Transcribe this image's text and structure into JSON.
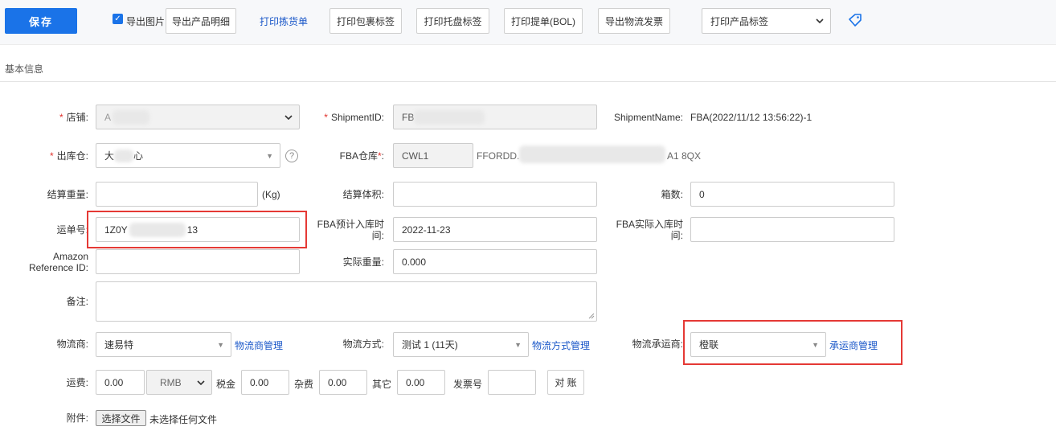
{
  "toolbar": {
    "save": "保存",
    "export_images": "导出图片",
    "export_products": "导出产品明细",
    "print_picklist": "打印拣货单",
    "print_package": "打印包裹标签",
    "print_pallet": "打印托盘标签",
    "print_bol": "打印提单(BOL)",
    "export_invoice": "导出物流发票",
    "print_product_select": "打印产品标签"
  },
  "section_title": "基本信息",
  "form": {
    "store": {
      "label": "店铺",
      "value": "A"
    },
    "shipment_id": {
      "label": "ShipmentID",
      "value": "FB"
    },
    "shipment_name": {
      "label": "ShipmentName",
      "value": "FBA(2022/11/12 13:56:22)-1"
    },
    "warehouse_out": {
      "label": "出库仓",
      "value_a": "大",
      "value_b": "心"
    },
    "fba_warehouse": {
      "label": "FBA仓库",
      "code": "CWL1",
      "addr_a": "FFORDD.",
      "addr_b": "A1 8QX"
    },
    "settle_weight": {
      "label": "结算重量",
      "unit": "(Kg)",
      "value": ""
    },
    "settle_volume": {
      "label": "结算体积",
      "value": ""
    },
    "box_count": {
      "label": "箱数",
      "value": "0"
    },
    "tracking_no": {
      "label": "运单号",
      "value_a": "1Z0Y",
      "value_b": "13"
    },
    "fba_expected": {
      "label_1": "FBA预计入库时",
      "label_2": "间",
      "value": "2022-11-23"
    },
    "fba_actual": {
      "label_1": "FBA实际入库时",
      "label_2": "间",
      "value": ""
    },
    "amazon_ref": {
      "label_1": "Amazon",
      "label_2": "Reference ID",
      "value": ""
    },
    "actual_weight": {
      "label": "实际重量",
      "value": "0.000"
    },
    "remark": {
      "label": "备注",
      "value": ""
    },
    "logistics_provider": {
      "label": "物流商",
      "value": "速易特",
      "manage": "物流商管理"
    },
    "logistics_method": {
      "label": "物流方式",
      "value": "测试 1 (11天)",
      "manage": "物流方式管理"
    },
    "carrier": {
      "label": "物流承运商",
      "value": "橙联",
      "manage": "承运商管理"
    },
    "freight": {
      "label": "运费",
      "value": "0.00",
      "currency": "RMB"
    },
    "tax": {
      "label": "税金",
      "value": "0.00"
    },
    "misc": {
      "label": "杂费",
      "value": "0.00"
    },
    "other": {
      "label": "其它",
      "value": "0.00"
    },
    "invoice_no": {
      "label": "发票号",
      "value": ""
    },
    "reconcile": "对 账",
    "attachment": {
      "label": "附件",
      "button": "选择文件",
      "status": "未选择任何文件"
    }
  },
  "colors": {
    "primary": "#1a73e8",
    "link": "#1a57c8",
    "highlight": "#e53935",
    "required": "#e0312b"
  }
}
